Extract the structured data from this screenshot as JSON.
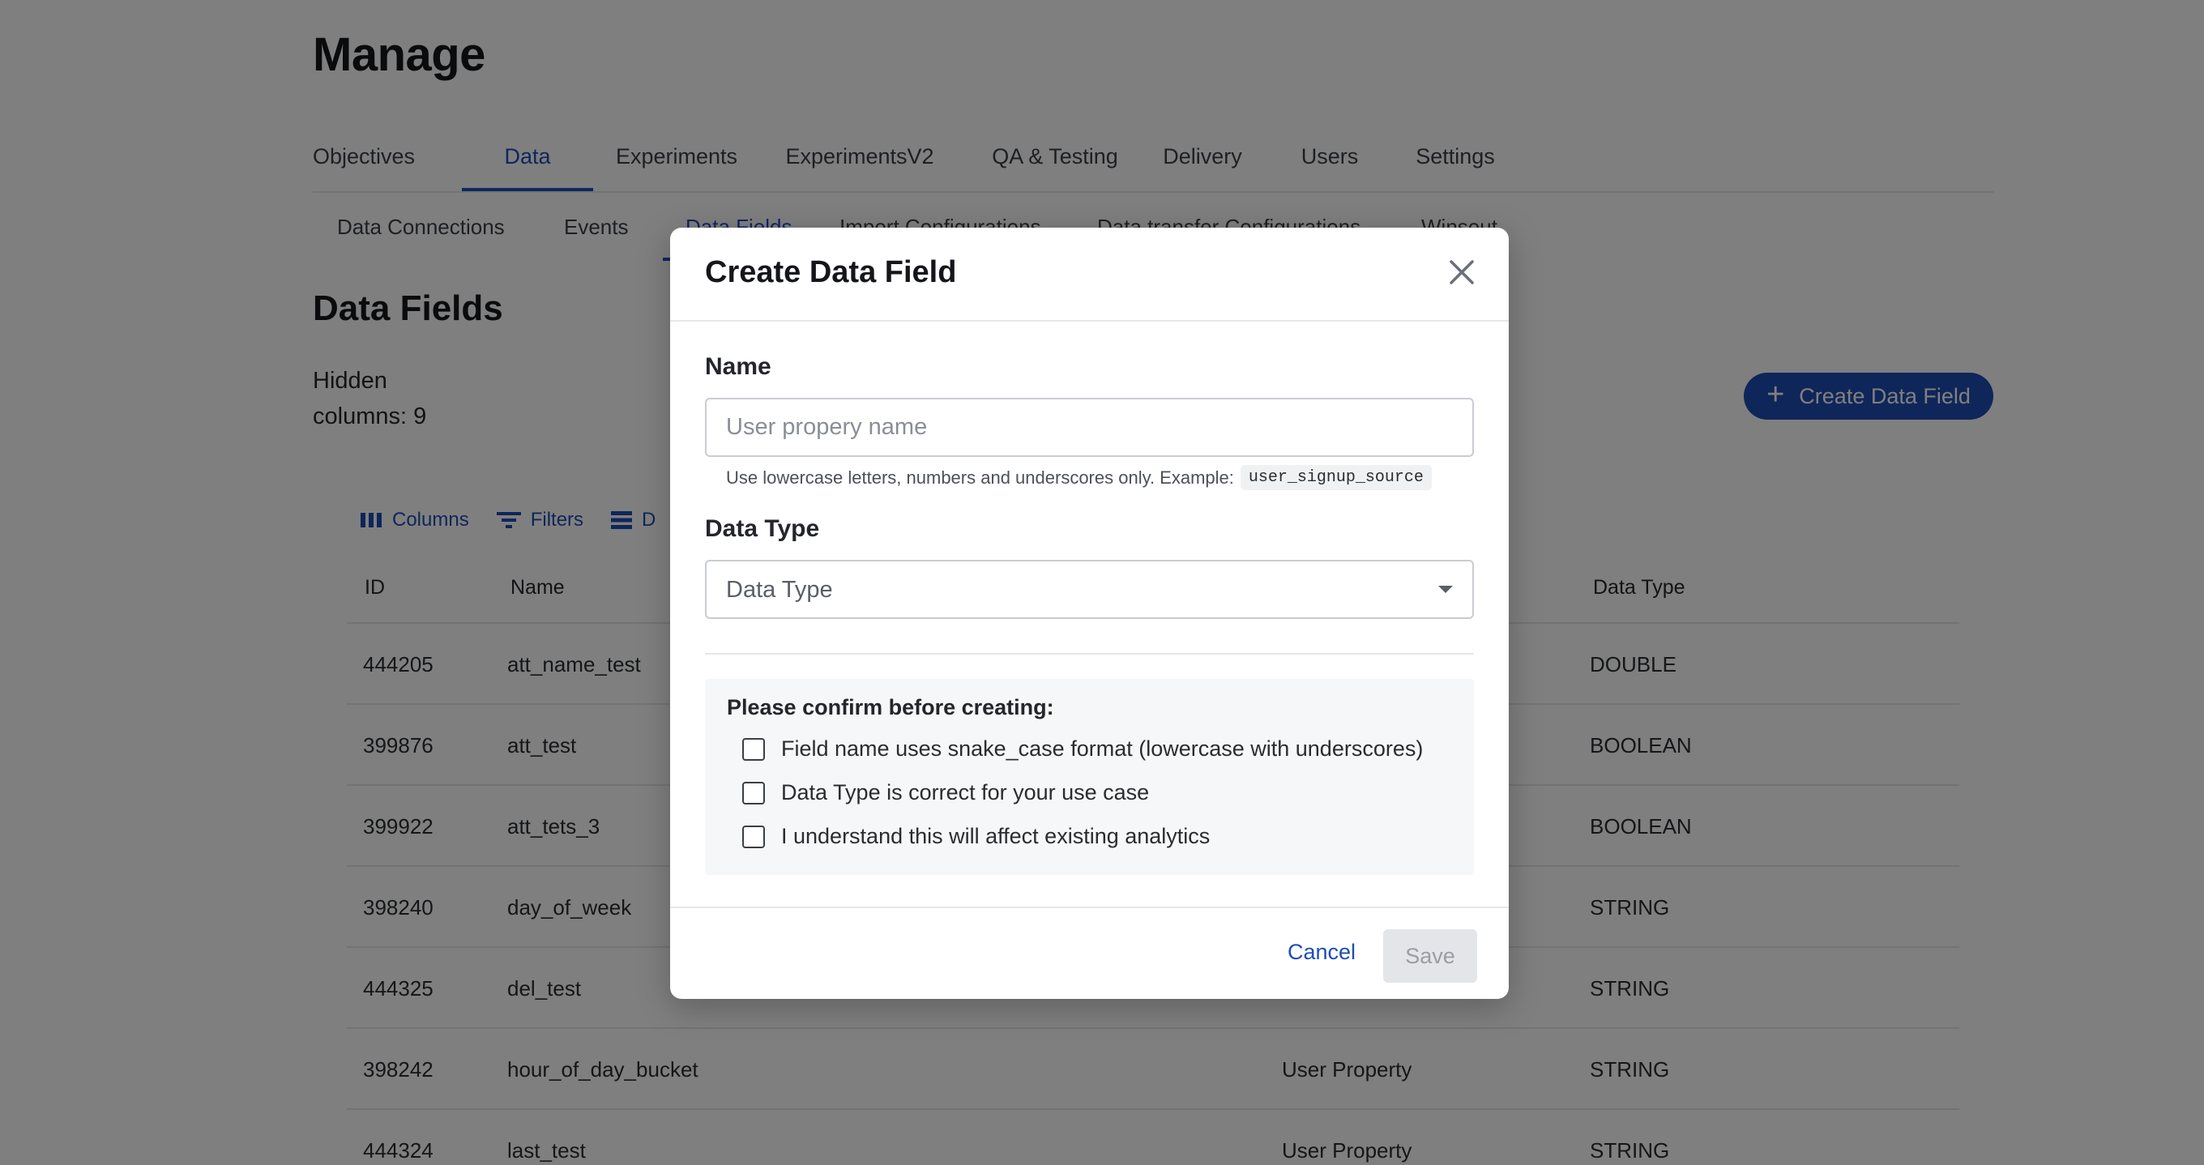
{
  "page": {
    "title": "Manage"
  },
  "tabs": [
    {
      "label": "Objectives"
    },
    {
      "label": "Data",
      "active": true
    },
    {
      "label": "Experiments"
    },
    {
      "label": "ExperimentsV2"
    },
    {
      "label": "QA & Testing"
    },
    {
      "label": "Delivery"
    },
    {
      "label": "Users"
    },
    {
      "label": "Settings"
    }
  ],
  "subtabs": [
    {
      "label": "Data Connections"
    },
    {
      "label": "Events"
    },
    {
      "label": "Data Fields",
      "active": true
    },
    {
      "label": "Import Configurations"
    },
    {
      "label": "Data transfer Configurations"
    },
    {
      "label": "Winsout"
    }
  ],
  "section": {
    "title": "Data Fields",
    "hidden_columns": "Hidden columns: 9",
    "create_button": "Create Data Field"
  },
  "toolbar": {
    "columns": "Columns",
    "filters": "Filters",
    "density": "D"
  },
  "table": {
    "headers": {
      "id": "ID",
      "name": "Name",
      "data_type": "Data Type"
    },
    "rows": [
      {
        "id": "444205",
        "name": "att_name_test",
        "source": "",
        "data_type": "DOUBLE"
      },
      {
        "id": "399876",
        "name": "att_test",
        "source": "",
        "data_type": "BOOLEAN"
      },
      {
        "id": "399922",
        "name": "att_tets_3",
        "source": "",
        "data_type": "BOOLEAN"
      },
      {
        "id": "398240",
        "name": "day_of_week",
        "source": "",
        "data_type": "STRING"
      },
      {
        "id": "444325",
        "name": "del_test",
        "source": "",
        "data_type": "STRING"
      },
      {
        "id": "398242",
        "name": "hour_of_day_bucket",
        "source": "User Property",
        "data_type": "STRING"
      },
      {
        "id": "444324",
        "name": "last_test",
        "source": "User Property",
        "data_type": "STRING"
      }
    ]
  },
  "modal": {
    "title": "Create Data Field",
    "name_label": "Name",
    "name_placeholder": "User propery name",
    "name_value": "",
    "hint_text": "Use lowercase letters, numbers and underscores only. Example:",
    "hint_example": "user_signup_source",
    "type_label": "Data Type",
    "type_placeholder": "Data Type",
    "confirm_title": "Please confirm before creating:",
    "checks": [
      {
        "label": "Field name uses snake_case format (lowercase with underscores)",
        "checked": false
      },
      {
        "label": "Data Type is correct for your use case",
        "checked": false
      },
      {
        "label": "I understand this will affect existing analytics",
        "checked": false
      }
    ],
    "cancel_label": "Cancel",
    "save_label": "Save"
  },
  "colors": {
    "accent": "#1f4db5",
    "overlay": "rgba(0,0,0,0.5)"
  }
}
